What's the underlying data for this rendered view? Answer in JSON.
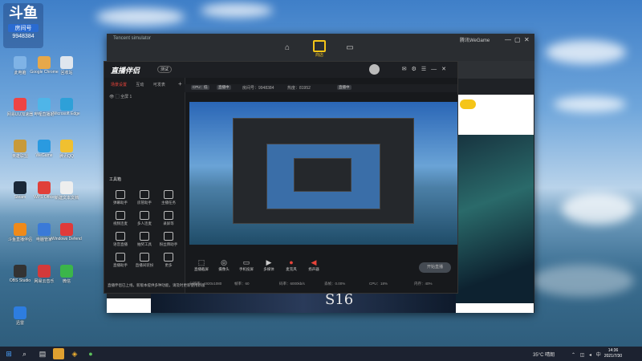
{
  "overlay": {
    "logo": "斗鱼",
    "tag": "房间号",
    "room": "9948384"
  },
  "desktop_icons": [
    {
      "label": "此电脑",
      "color": "#7fb3e6"
    },
    {
      "label": "Google Chrome",
      "color": "#e6a84a"
    },
    {
      "label": "回收站",
      "color": "#dfe6ee"
    },
    {
      "label": "网易UU加速器",
      "color": "#e44"
    },
    {
      "label": "哔哩直播姬",
      "color": "#4fb5e8"
    },
    {
      "label": "Microsoft Edge",
      "color": "#2ea0d8"
    },
    {
      "label": "英雄联盟",
      "color": "#c89a3a"
    },
    {
      "label": "WeGame",
      "color": "#2a9ae0"
    },
    {
      "label": "腾讯QQ",
      "color": "#f0c030"
    },
    {
      "label": "Steam",
      "color": "#1b2838"
    },
    {
      "label": "WPS Office",
      "color": "#e0403a"
    },
    {
      "label": "新建文本文档",
      "color": "#eeeeee"
    },
    {
      "label": "斗鱼直播伴侣",
      "color": "#f08a1a"
    },
    {
      "label": "电脑管家",
      "color": "#3a7ad8"
    },
    {
      "label": "Windows Defender",
      "color": "#e03a3a"
    },
    {
      "label": "OBS Studio",
      "color": "#333333"
    },
    {
      "label": "网易云音乐",
      "color": "#d33a3a"
    },
    {
      "label": "微信",
      "color": "#3bb54a"
    },
    {
      "label": "迅雷",
      "color": "#2d7de0"
    }
  ],
  "outer_window": {
    "title": "Tencent simulator",
    "nav_label": "商店",
    "right_text": "腾讯WeGame",
    "controls": [
      "—",
      "▢",
      "✕"
    ]
  },
  "app": {
    "brand": "直播伴侣",
    "version": "测试",
    "side_tabs": [
      "场景设置",
      "互动",
      "可发表"
    ],
    "scene_label": "全屏 1",
    "toolbox_title": "工具箱",
    "tools": [
      "弹幕助手",
      "房管助手",
      "主播任务",
      "视频连麦",
      "多人连麦",
      "录屏等",
      "语音直播",
      "抽奖工具",
      "粉丝牌助手",
      "直播助手",
      "直播间装扮",
      "更多"
    ],
    "notice": "直播伴侣已上线，新版本提供多种功能，请及时更新使用新版",
    "status": {
      "tag1": "CPU：低",
      "tag2": "直播中",
      "room": "房间号：9948384",
      "viewers": "热度：81952",
      "pin_label": "直播中"
    },
    "controls": [
      "直播截屏",
      "摄像头",
      "手机投屏",
      "多媒体",
      "麦克风",
      "扬声器"
    ],
    "golive": "开始直播",
    "bottom_stats": [
      "分辨率：1920x1080",
      "帧率：60",
      "码率：6000kb/s",
      "丢帧：0.00%",
      "CPU：18%",
      "内存：40%"
    ]
  },
  "page_banner": "S16",
  "taskbar": {
    "weather": "35°C 晴朗",
    "clock_time": "14:36",
    "clock_date": "2021/7/30"
  }
}
